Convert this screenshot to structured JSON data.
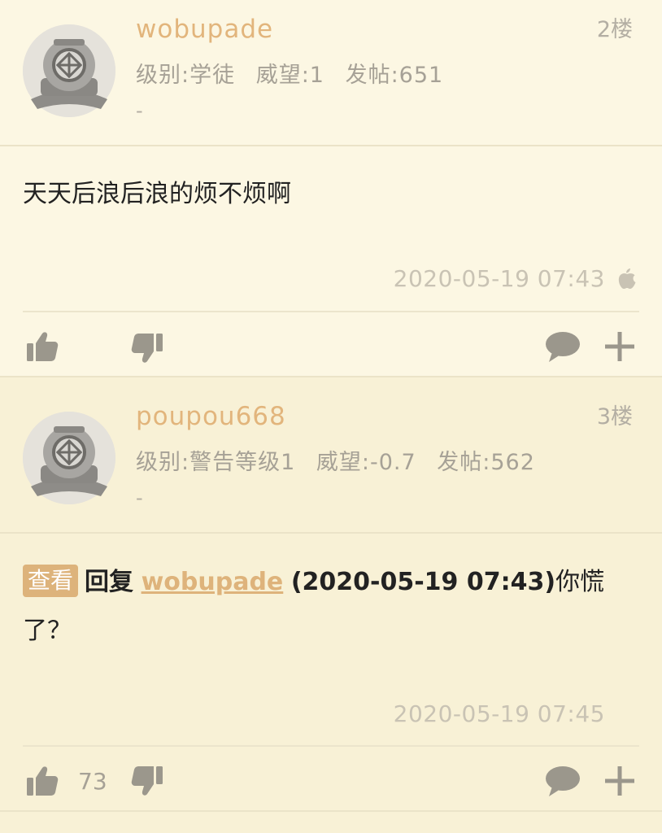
{
  "posts": [
    {
      "username": "wobupade",
      "level": "级别:学徒",
      "reputation": "威望:1",
      "post_count": "发帖:651",
      "signature": "-",
      "floor": "2楼",
      "content": "天天后浪后浪的烦不烦啊",
      "timestamp": "2020-05-19 07:43",
      "device_icon": "apple-icon",
      "like_count": ""
    },
    {
      "username": "poupou668",
      "level": "级别:警告等级1",
      "reputation": "威望:-0.7",
      "post_count": "发帖:562",
      "signature": "-",
      "floor": "3楼",
      "reply_tag": "查看",
      "reply_word": "回复",
      "reply_user": "wobupade",
      "reply_time": "(2020-05-19 07:43)",
      "content": "你慌了？",
      "timestamp": "2020-05-19 07:45",
      "like_count": "73"
    }
  ],
  "icons": {
    "like": "thumbs-up-icon",
    "dislike": "thumbs-down-icon",
    "comment": "comment-icon",
    "add": "plus-icon",
    "avatar": "diving-helmet-avatar"
  },
  "colors": {
    "username": "#e2b57c",
    "meta": "#a6a196",
    "icon": "#9b978c",
    "reply_tag_bg": "#ddb37b"
  }
}
